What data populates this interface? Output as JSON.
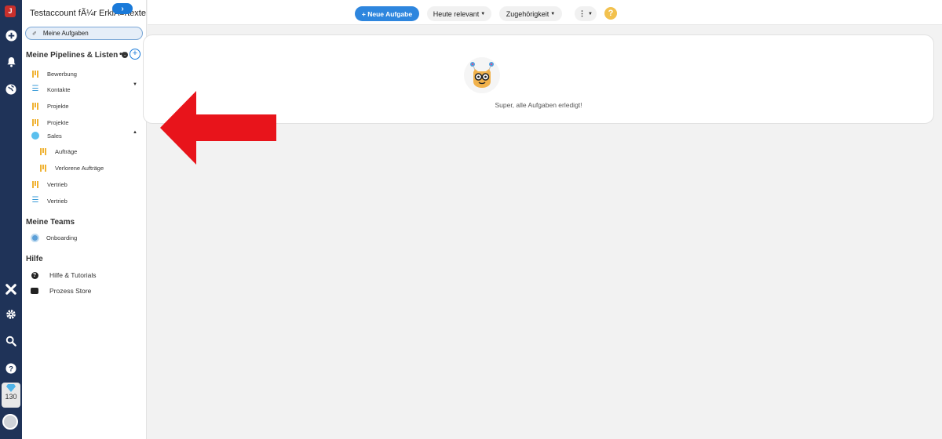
{
  "rail": {
    "logo": "J",
    "credits": "130",
    "icons": [
      "add-icon",
      "bell-icon",
      "globe-icon",
      "tools-icon",
      "gear-icon",
      "search-icon",
      "help-icon"
    ]
  },
  "sidebar": {
    "account_name": "Testaccount fÃ¼r ErklÃ¤rtexte",
    "collapse_label": "›",
    "my_tasks": "Meine Aufgaben",
    "pipelines_title": "Meine Pipelines & Listen",
    "pipelines_more": "•••",
    "pipelines_add": "+",
    "items": [
      {
        "label": "Bewerbung",
        "icon": "pipeline-icon"
      },
      {
        "label": "Kontakte",
        "icon": "list-icon"
      },
      {
        "label": "Projekte",
        "icon": "pipeline-icon"
      },
      {
        "label": "Projekte",
        "icon": "pipeline-icon"
      },
      {
        "label": "Sales",
        "icon": "folder-circle-icon"
      },
      {
        "label": "Aufträge",
        "icon": "pipeline-icon"
      },
      {
        "label": "Verlorene Aufträge",
        "icon": "pipeline-icon"
      },
      {
        "label": "Vertrieb",
        "icon": "pipeline-icon"
      },
      {
        "label": "Vertrieb",
        "icon": "list-icon"
      }
    ],
    "teams_title": "Meine Teams",
    "teams": [
      {
        "label": "Onboarding"
      }
    ],
    "help_title": "Hilfe",
    "help_items": [
      {
        "label": "Hilfe & Tutorials"
      },
      {
        "label": "Prozess Store"
      }
    ]
  },
  "topbar": {
    "new_task": "+ Neue Aufgabe",
    "filter_relevance": "Heute relevant",
    "filter_membership": "Zugehörigkeit",
    "more_menu": "⋮",
    "help": "?"
  },
  "main": {
    "empty_message": "Super, alle Aufgaben erledigt!"
  },
  "colors": {
    "rail": "#1f3358",
    "primary": "#2e86de",
    "pipeline": "#f0b232",
    "arrow": "#e8141b"
  }
}
